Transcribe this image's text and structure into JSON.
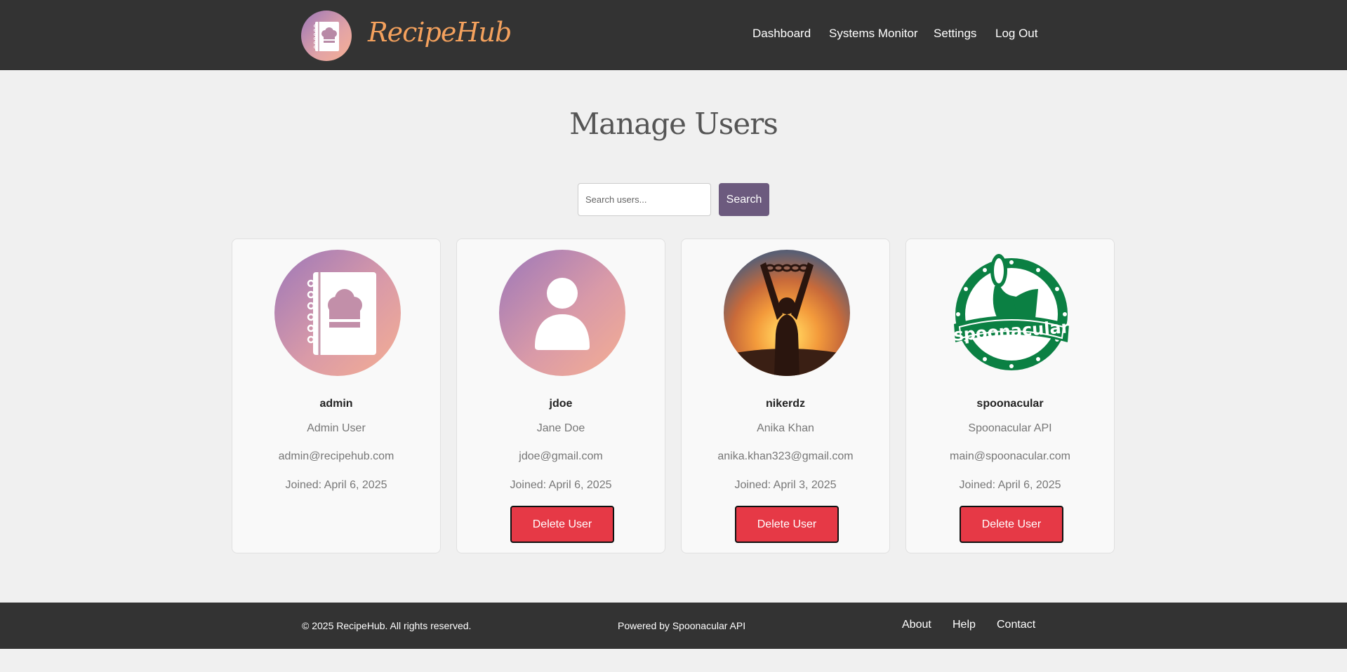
{
  "header": {
    "brand": "RecipeHub",
    "nav": [
      {
        "label": "Dashboard"
      },
      {
        "label": "Systems Monitor"
      },
      {
        "label": "Settings"
      },
      {
        "label": "Log Out"
      }
    ]
  },
  "main": {
    "title": "Manage Users",
    "search": {
      "placeholder": "Search users...",
      "value": "",
      "button_label": "Search"
    },
    "users": [
      {
        "username": "admin",
        "name": "Admin User",
        "email": "admin@recipehub.com",
        "joined": "Joined: April 6, 2025",
        "avatar": "cookbook-logo-icon",
        "delete_label": ""
      },
      {
        "username": "jdoe",
        "name": "Jane Doe",
        "email": "jdoe@gmail.com",
        "joined": "Joined: April 6, 2025",
        "avatar": "default-user-icon",
        "delete_label": "Delete User"
      },
      {
        "username": "nikerdz",
        "name": "Anika Khan",
        "email": "anika.khan323@gmail.com",
        "joined": "Joined: April 3, 2025",
        "avatar": "sunset-silhouette-photo",
        "delete_label": "Delete User"
      },
      {
        "username": "spoonacular",
        "name": "Spoonacular API",
        "email": "main@spoonacular.com",
        "joined": "Joined: April 6, 2025",
        "avatar": "spoonacular-logo",
        "delete_label": "Delete User"
      }
    ]
  },
  "footer": {
    "copyright": "© 2025 RecipeHub. All rights reserved.",
    "powered_by": "Powered by Spoonacular API",
    "links": [
      {
        "label": "About"
      },
      {
        "label": "Help"
      },
      {
        "label": "Contact"
      }
    ]
  },
  "colors": {
    "header_bg": "#333333",
    "brand": "#f4a15d",
    "search_button": "#6c5a7e",
    "delete_button": "#e63946",
    "spoonacular_green": "#0b8043"
  }
}
